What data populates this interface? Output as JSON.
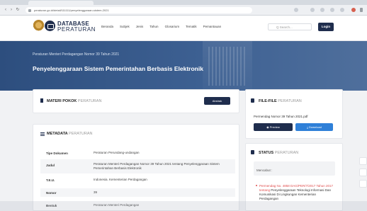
{
  "browser": {
    "url": "peraturan.go.id/detail/111111/penyelenggaraan-sistem-2021"
  },
  "header": {
    "brand_top": "DATABASE",
    "brand_bottom": "PERATURAN",
    "nav": [
      "Beranda",
      "Subjek",
      "Jenis",
      "Tahun",
      "Glosarium",
      "Tematik",
      "Pemantauan"
    ],
    "search_placeholder": "Q Search...",
    "login_label": "Login"
  },
  "hero": {
    "subtitle": "Peraturan Menteri Perdagangan Nomor 39 Tahun 2021",
    "title": "Penyelenggaraan Sistem Pemerintahan Berbasis Elektronik"
  },
  "materi": {
    "title_bold": "MATERI POKOK",
    "title_light": "PERATURAN",
    "abstrak_label": "Abstrak"
  },
  "files": {
    "title_bold": "FILE-FILE",
    "title_light": "PERATURAN",
    "file_name": "Permendag Nomor 39 Tahun 2021.pdf",
    "preview_label": "Preview",
    "download_label": "Download"
  },
  "metadata": {
    "title_bold": "METADATA",
    "title_light": "PERATURAN",
    "rows": [
      {
        "key": "Tipe Dokumen",
        "value": "Peraturan Perundang-undangan"
      },
      {
        "key": "Judul",
        "value": "Peraturan Menteri Perdagangan Nomor 39 Tahun 2021 tentang Penyelenggaraan Sistem Pemerintahan Berbasis Elektronik"
      },
      {
        "key": "T.E.U.",
        "value": "Indonesia. Kementerian Perdagangan"
      },
      {
        "key": "Nomor",
        "value": "39"
      },
      {
        "key": "Bentuk",
        "value": "Peraturan Menteri Perdagangan"
      }
    ]
  },
  "status": {
    "title_bold": "STATUS",
    "title_light": "PERATURAN",
    "label": "Mencabut :",
    "item_red": "Permendag No. 4858 DAG/PER/7/2017 Tahun 2017",
    "item_connector": "tentang",
    "item_plain": "Penyelenggaraan Teknologi Informasi Dan Komunikasi Di Lingkungan Kementerian Perdagangan"
  },
  "colors": {
    "navy": "#1f2d4d",
    "hero": "#2d4e7e",
    "download": "#2f80d8",
    "status_red": "#e04e4e"
  }
}
